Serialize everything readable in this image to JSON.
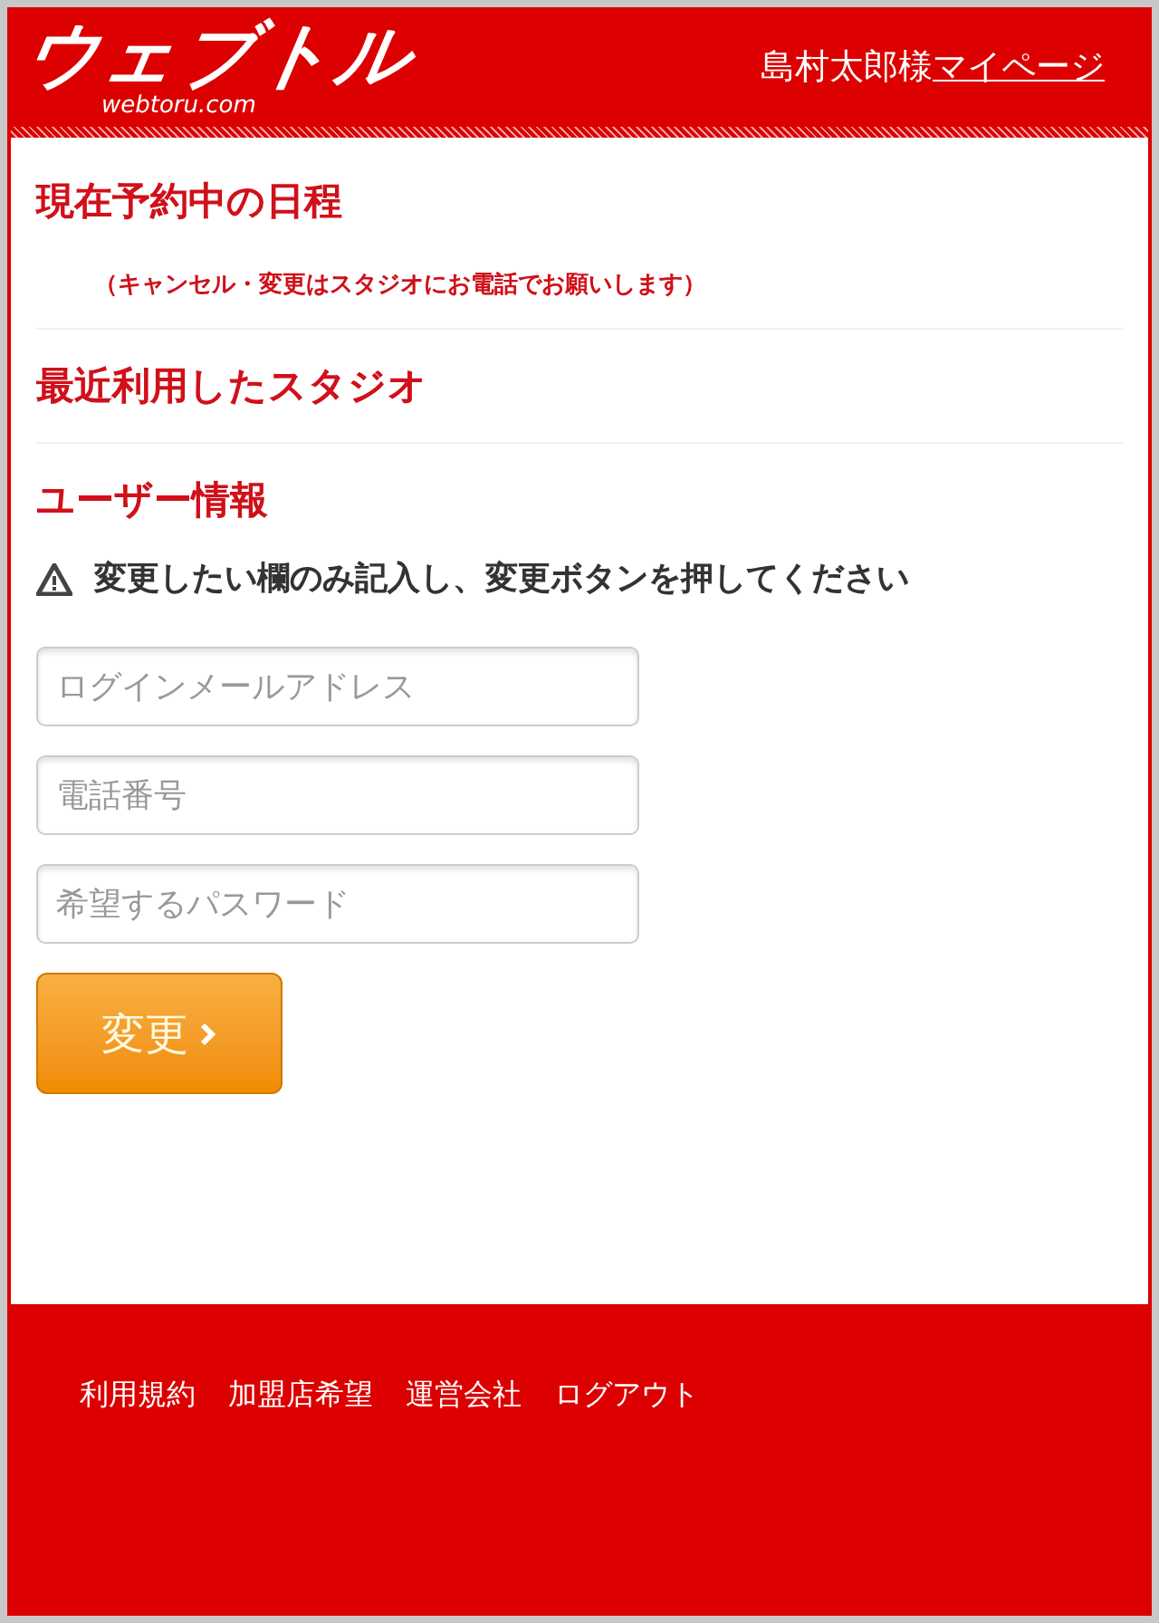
{
  "header": {
    "logo": "ウェブトル",
    "logo_sub": "webtoru.com",
    "user_name": "島村太郎様",
    "mypage_link": "マイページ"
  },
  "sections": [
    {
      "title": "現在予約中の日程",
      "note": "（キャンセル・変更はスタジオにお電話でお願いします）"
    },
    {
      "title": "最近利用したスタジオ"
    }
  ],
  "user_info": {
    "title": "ユーザー情報",
    "warning": "変更したい欄のみ記入し、変更ボタンを押してください",
    "fields": [
      {
        "placeholder": "ログインメールアドレス"
      },
      {
        "placeholder": "電話番号"
      },
      {
        "placeholder": "希望するパスワード"
      }
    ],
    "submit": "変更"
  },
  "footer_links": [
    "利用規約",
    "加盟店希望",
    "運営会社",
    "ログアウト"
  ]
}
